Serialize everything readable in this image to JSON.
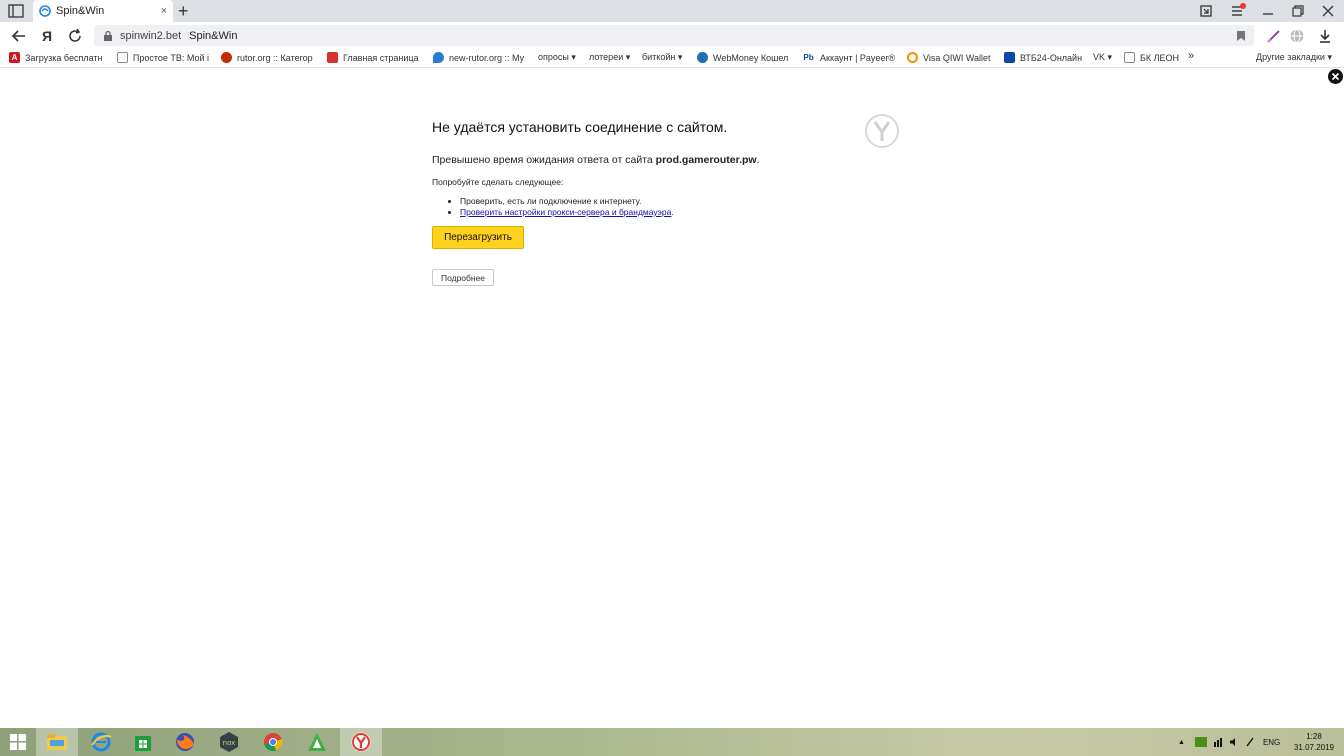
{
  "tab": {
    "title": "Spin&Win",
    "close": "×"
  },
  "newtab": "+",
  "omnibox": {
    "domain": "spinwin2.bet",
    "page_title": "Spin&Win"
  },
  "nav": {
    "yandex": "Я"
  },
  "bookmarks": [
    {
      "label": "Загрузка бесплатн",
      "icon": "adobe-icon",
      "color": "#d4141e"
    },
    {
      "label": "Простое ТВ: Мой і",
      "icon": "page-icon",
      "color": "#888888"
    },
    {
      "label": "rutor.org :: Категор",
      "icon": "rutor-icon",
      "color": "#c62a00"
    },
    {
      "label": "Главная страница",
      "icon": "red-page-icon",
      "color": "#d43030"
    },
    {
      "label": "new-rutor.org :: Му",
      "icon": "pin-icon",
      "color": "#2a7ad4"
    },
    {
      "label": "опросы ▾",
      "icon": "",
      "color": ""
    },
    {
      "label": "лотереи ▾",
      "icon": "",
      "color": ""
    },
    {
      "label": "биткойн ▾",
      "icon": "",
      "color": ""
    },
    {
      "label": "WebMoney Кошел",
      "icon": "webmoney-icon",
      "color": "#1f6fb5"
    },
    {
      "label": "Аккаунт | Payeer®",
      "icon": "payeer-icon",
      "color": "#0b4e8f"
    },
    {
      "label": "Visa QIWI Wallet",
      "icon": "qiwi-icon",
      "color": "#ff8c00"
    },
    {
      "label": "ВТБ24-Онлайн",
      "icon": "vtb-icon",
      "color": "#1048a8"
    },
    {
      "label": "VK ▾",
      "icon": "",
      "color": ""
    },
    {
      "label": "БК ЛЕОН",
      "icon": "page-icon",
      "color": "#888888"
    },
    {
      "label": "»",
      "icon": "",
      "color": ""
    }
  ],
  "other_bookmarks": "Другие закладки ▾",
  "error": {
    "title": "Не удаётся установить соединение с сайтом.",
    "desc_prefix": "Превышено время ожидания ответа от сайта ",
    "desc_host": "prod.gamerouter.pw",
    "desc_suffix": ".",
    "try": "Попробуйте сделать следующее:",
    "tip1": "Проверить, есть ли подключение к интернету.",
    "tip2": "Проверить настройки прокси-сервера и брандмауэра",
    "tip2_suffix": ".",
    "reload": "Перезагрузить",
    "details": "Подробнее"
  },
  "tray": {
    "lang": "ENG",
    "time": "1:28",
    "date": "31.07.2019"
  },
  "colors": {
    "accent": "#ffd21e",
    "link": "#1a0dab"
  }
}
